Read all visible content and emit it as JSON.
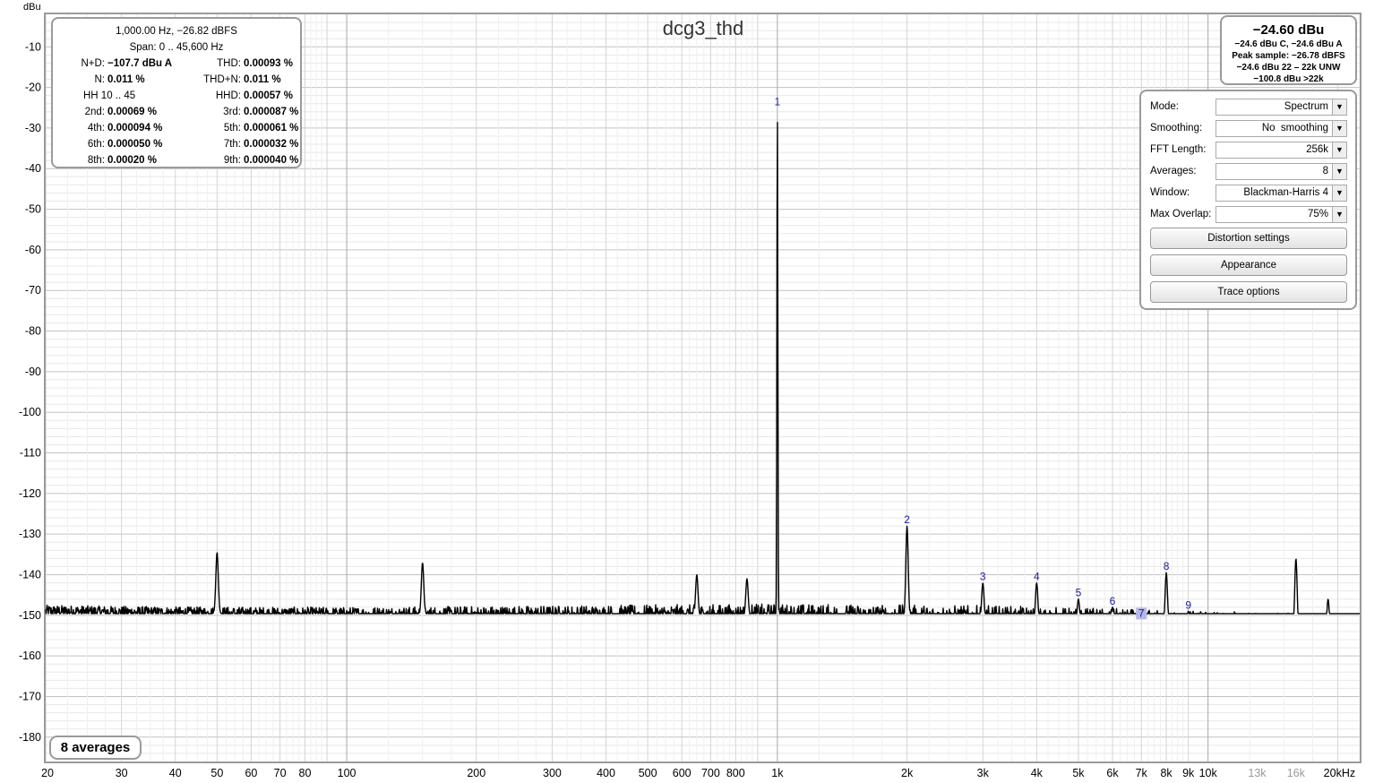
{
  "chart_data": {
    "type": "line",
    "title": "dcg3_thd",
    "ylabel": "dBu",
    "yticks": [
      "-10",
      "-20",
      "-30",
      "-40",
      "-50",
      "-60",
      "-70",
      "-80",
      "-90",
      "-100",
      "-110",
      "-120",
      "-130",
      "-140",
      "-150",
      "-160",
      "-170",
      "-180"
    ],
    "xticks": [
      {
        "f": 20,
        "label": "20"
      },
      {
        "f": 30,
        "label": "30"
      },
      {
        "f": 40,
        "label": "40"
      },
      {
        "f": 50,
        "label": "50"
      },
      {
        "f": 60,
        "label": "60"
      },
      {
        "f": 70,
        "label": "70"
      },
      {
        "f": 80,
        "label": "80"
      },
      {
        "f": 100,
        "label": "100"
      },
      {
        "f": 200,
        "label": "200"
      },
      {
        "f": 300,
        "label": "300"
      },
      {
        "f": 400,
        "label": "400"
      },
      {
        "f": 500,
        "label": "500"
      },
      {
        "f": 600,
        "label": "600"
      },
      {
        "f": 700,
        "label": "700"
      },
      {
        "f": 800,
        "label": "800"
      },
      {
        "f": 1000,
        "label": "1k"
      },
      {
        "f": 2000,
        "label": "2k"
      },
      {
        "f": 3000,
        "label": "3k"
      },
      {
        "f": 4000,
        "label": "4k"
      },
      {
        "f": 5000,
        "label": "5k"
      },
      {
        "f": 6000,
        "label": "6k"
      },
      {
        "f": 7000,
        "label": "7k"
      },
      {
        "f": 8000,
        "label": "8k"
      },
      {
        "f": 9000,
        "label": "9k"
      },
      {
        "f": 10000,
        "label": "10k"
      },
      {
        "f": 13000,
        "label": "13k",
        "grey": true
      },
      {
        "f": 16000,
        "label": "16k",
        "grey": true
      },
      {
        "f": 20000,
        "label": "20kHz"
      }
    ],
    "xlim": [
      20,
      22500
    ],
    "ylim": [
      -186,
      -2
    ],
    "xscale": "log",
    "grid": true,
    "noise_floor": [
      [
        20,
        -149
      ],
      [
        100,
        -150
      ],
      [
        1000,
        -150.5
      ],
      [
        3000,
        -151.5
      ],
      [
        10000,
        -153.5
      ],
      [
        22000,
        -155
      ]
    ],
    "peaks": [
      {
        "f": 50,
        "db": -134.5
      },
      {
        "f": 150,
        "db": -137
      },
      {
        "f": 650,
        "db": -140
      },
      {
        "f": 850,
        "db": -141
      },
      {
        "f": 1000,
        "db": -25
      },
      {
        "f": 2000,
        "db": -128
      },
      {
        "f": 3000,
        "db": -142
      },
      {
        "f": 4000,
        "db": -142
      },
      {
        "f": 5000,
        "db": -146
      },
      {
        "f": 6000,
        "db": -148
      },
      {
        "f": 7000,
        "db": -151
      },
      {
        "f": 8000,
        "db": -139.5
      },
      {
        "f": 9000,
        "db": -149
      },
      {
        "f": 16000,
        "db": -136
      },
      {
        "f": 19000,
        "db": -146
      }
    ],
    "harmonic_markers": [
      {
        "label": "1",
        "f": 1000,
        "db": -25
      },
      {
        "label": "2",
        "f": 2000,
        "db": -128
      },
      {
        "label": "3",
        "f": 3000,
        "db": -142
      },
      {
        "label": "4",
        "f": 4000,
        "db": -142
      },
      {
        "label": "5",
        "f": 5000,
        "db": -146
      },
      {
        "label": "6",
        "f": 6000,
        "db": -148
      },
      {
        "label": "7",
        "f": 7000,
        "db": -151
      },
      {
        "label": "8",
        "f": 8000,
        "db": -139.5
      },
      {
        "label": "9",
        "f": 9000,
        "db": -149
      }
    ]
  },
  "stats": {
    "header": "1,000.00 Hz, −26.82 dBFS",
    "span": "Span: 0 .. 45,600 Hz",
    "rows": [
      [
        {
          "l": "N+D:",
          "v": "−107.7 dBu A"
        },
        {
          "l": "THD:",
          "v": "0.00093 %"
        }
      ],
      [
        {
          "l": "N:",
          "v": "0.011 %"
        },
        {
          "l": "THD+N:",
          "v": "0.011 %"
        }
      ],
      [
        {
          "l": "",
          "v": "HH 10 .. 45",
          "plain": true
        },
        {
          "l": "HHD:",
          "v": "0.00057 %"
        }
      ],
      [
        {
          "l": "2nd:",
          "v": "0.00069 %"
        },
        {
          "l": "3rd:",
          "v": "0.000087 %"
        }
      ],
      [
        {
          "l": "4th:",
          "v": "0.000094 %"
        },
        {
          "l": "5th:",
          "v": "0.000061 %"
        }
      ],
      [
        {
          "l": "6th:",
          "v": "0.000050 %"
        },
        {
          "l": "7th:",
          "v": "0.000032 %"
        }
      ],
      [
        {
          "l": "8th:",
          "v": "0.00020 %"
        },
        {
          "l": "9th:",
          "v": "0.000040 %"
        }
      ]
    ]
  },
  "level": {
    "main": "−24.60 dBu",
    "lines": [
      "−24.6 dBu C, −24.6 dBu A",
      "Peak sample: −26.78 dBFS",
      "−24.6 dBu 22 – 22k UNW",
      "−100.8 dBu >22k"
    ]
  },
  "controls": {
    "rows": [
      {
        "label": "Mode:",
        "value": "Spectrum"
      },
      {
        "label": "Smoothing:",
        "value": "No  smoothing"
      },
      {
        "label": "FFT Length:",
        "value": "256k"
      },
      {
        "label": "Averages:",
        "value": "8"
      },
      {
        "label": "Window:",
        "value": "Blackman-Harris 4"
      },
      {
        "label": "Max Overlap:",
        "value": "75%"
      }
    ],
    "buttons": [
      "Distortion settings",
      "Appearance",
      "Trace options"
    ]
  },
  "averages_badge": "8 averages",
  "colors": {
    "trace": "#000000",
    "marker": "#1a1aa8",
    "grid": "#d6d6d6",
    "major_grid": "#a8a8a8"
  }
}
